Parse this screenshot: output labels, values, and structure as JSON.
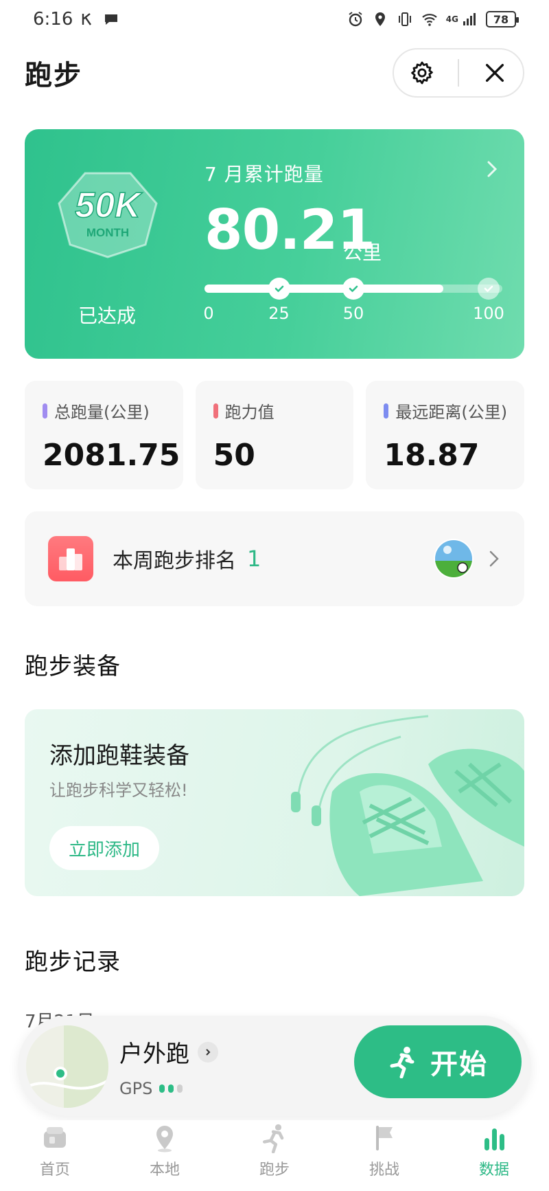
{
  "status_bar": {
    "time": "6:16",
    "battery": "78",
    "network": "4G"
  },
  "header": {
    "title": "跑步",
    "settings_icon": "gear-icon",
    "close_icon": "close-icon"
  },
  "hero": {
    "badge_title": "50K",
    "badge_sub": "MONTH",
    "badge_status": "已达成",
    "month_label": "7 月累计跑量",
    "value": "80.21",
    "unit": "公里",
    "progress_value": 80.21,
    "progress_max": 100,
    "milestones": [
      {
        "label": "0",
        "value": 0
      },
      {
        "label": "25",
        "value": 25,
        "achieved": true
      },
      {
        "label": "50",
        "value": 50,
        "achieved": true
      },
      {
        "label": "100",
        "value": 100,
        "achieved": false
      }
    ],
    "accent": "#2fc28d"
  },
  "stats": [
    {
      "label": "总跑量(公里)",
      "value": "2081.75",
      "color": "#a08cf0"
    },
    {
      "label": "跑力值",
      "value": "50",
      "color": "#f0707a"
    },
    {
      "label": "最远距离(公里)",
      "value": "18.87",
      "color": "#7d8cf0"
    }
  ],
  "ranking": {
    "label": "本周跑步排名",
    "value": "1"
  },
  "equipment": {
    "section_title": "跑步装备",
    "title": "添加跑鞋装备",
    "subtitle": "让跑步科学又轻松!",
    "button": "立即添加"
  },
  "records": {
    "section_title": "跑步记录",
    "date": "7月21日"
  },
  "run_bar": {
    "type": "户外跑",
    "gps": "GPS",
    "start": "开始"
  },
  "nav": [
    {
      "label": "首页",
      "icon": "home-icon"
    },
    {
      "label": "本地",
      "icon": "location-pin-icon"
    },
    {
      "label": "跑步",
      "icon": "runner-icon"
    },
    {
      "label": "挑战",
      "icon": "flag-icon"
    },
    {
      "label": "数据",
      "icon": "bar-chart-icon",
      "active": true
    }
  ]
}
